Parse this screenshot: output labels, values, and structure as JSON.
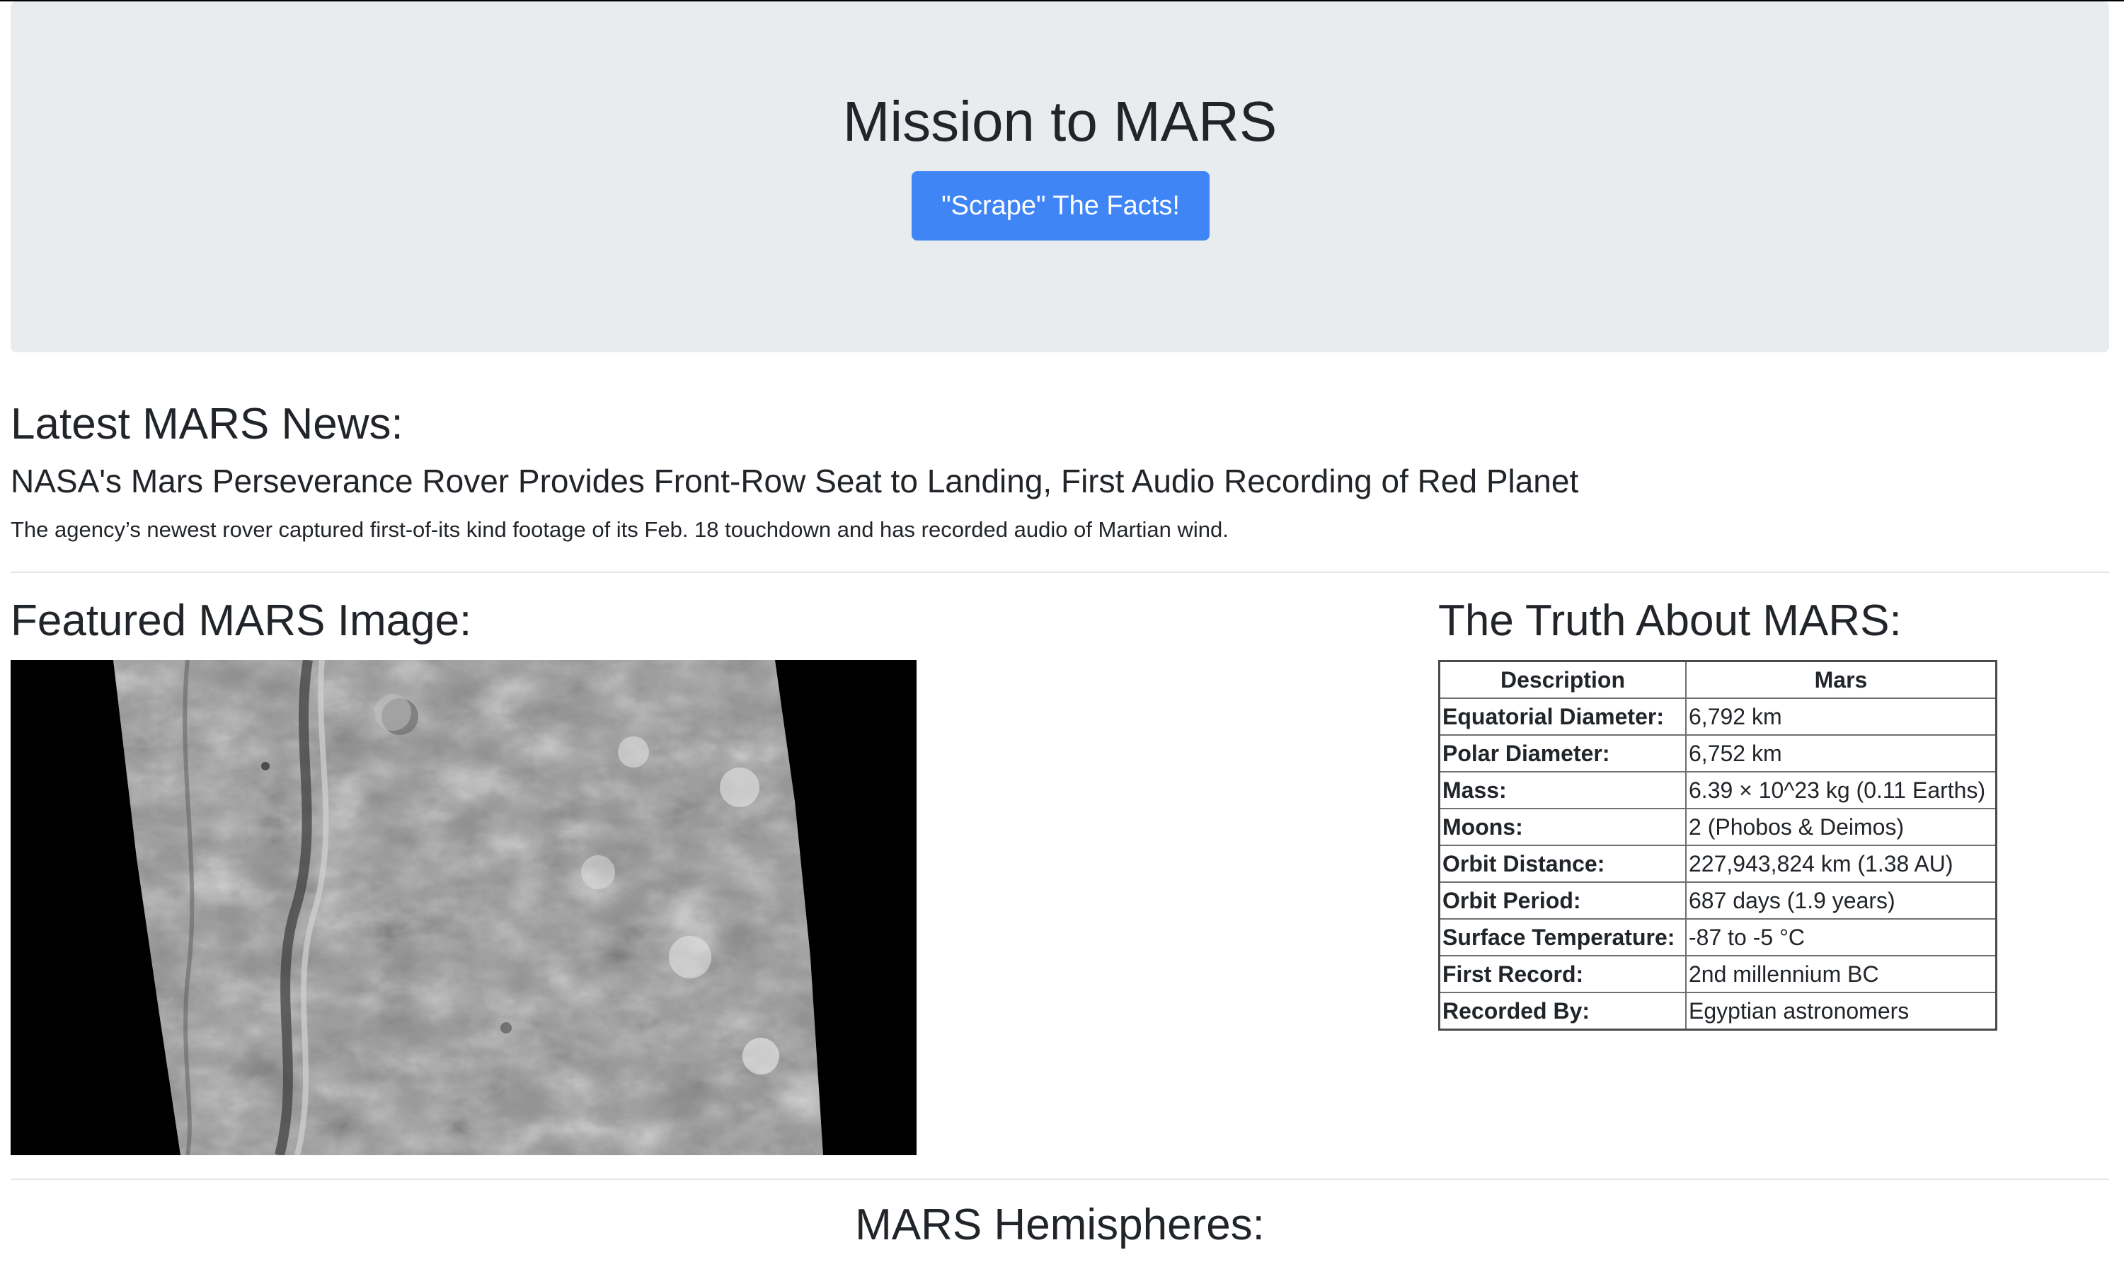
{
  "jumbotron": {
    "title": "Mission to MARS",
    "button_label": "\"Scrape\" The Facts!"
  },
  "news": {
    "section_title": "Latest MARS News:",
    "headline": "NASA's Mars Perseverance Rover Provides Front-Row Seat to Landing, First Audio Recording of Red Planet",
    "teaser": "The agency’s newest rover captured first-of-its kind footage of its Feb. 18 touchdown and has recorded audio of Martian wind."
  },
  "featured": {
    "section_title": "Featured MARS Image:"
  },
  "facts": {
    "section_title": "The Truth About MARS:",
    "columns": [
      "Description",
      "Mars"
    ],
    "rows": [
      {
        "label": "Equatorial Diameter:",
        "value": "6,792 km"
      },
      {
        "label": "Polar Diameter:",
        "value": "6,752 km"
      },
      {
        "label": "Mass:",
        "value": "6.39 × 10^23 kg (0.11 Earths)"
      },
      {
        "label": "Moons:",
        "value": "2 (Phobos & Deimos)"
      },
      {
        "label": "Orbit Distance:",
        "value": "227,943,824 km (1.38 AU)"
      },
      {
        "label": "Orbit Period:",
        "value": "687 days (1.9 years)"
      },
      {
        "label": "Surface Temperature:",
        "value": "-87 to -5 °C"
      },
      {
        "label": "First Record:",
        "value": "2nd millennium BC"
      },
      {
        "label": "Recorded By:",
        "value": "Egyptian astronomers"
      }
    ]
  },
  "hemispheres": {
    "section_title": "MARS Hemispheres:"
  },
  "colors": {
    "jumbotron_bg": "#e9ecef",
    "button_bg": "#3f85f5",
    "text": "#212529"
  }
}
